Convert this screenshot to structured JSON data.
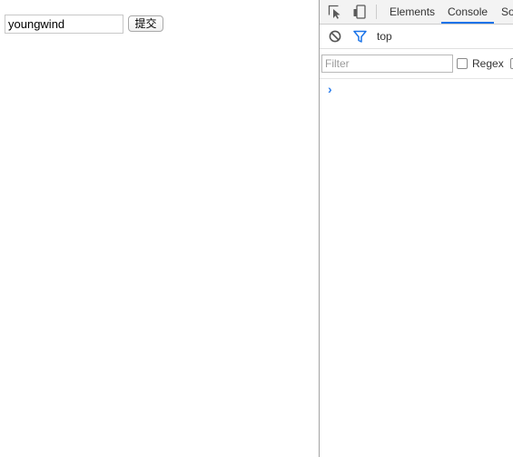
{
  "page": {
    "input_value": "youngwind",
    "submit_label": "提交"
  },
  "devtools": {
    "toolbar": {
      "inspect_icon": "inspect-element-icon",
      "device_icon": "device-toggle-icon",
      "tabs": [
        {
          "label": "Elements",
          "active": false
        },
        {
          "label": "Console",
          "active": true
        },
        {
          "label": "So",
          "active": false
        }
      ]
    },
    "console_bar": {
      "clear_icon": "clear-console-icon",
      "filter_icon": "filter-icon",
      "context": "top"
    },
    "filter_bar": {
      "filter_placeholder": "Filter",
      "regex_label": "Regex"
    },
    "prompt_glyph": "›",
    "accent_color": "#1a73e8"
  }
}
